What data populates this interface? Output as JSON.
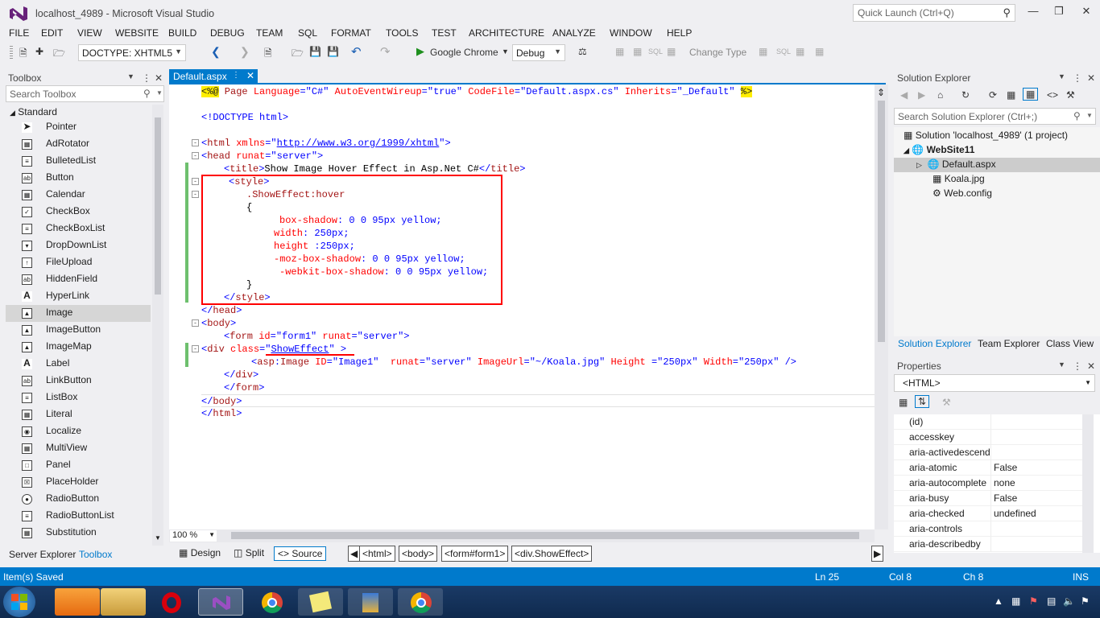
{
  "window": {
    "title": "localhost_4989 - Microsoft Visual Studio",
    "quick_launch": "Quick Launch (Ctrl+Q)"
  },
  "menu": [
    "FILE",
    "EDIT",
    "VIEW",
    "WEBSITE",
    "BUILD",
    "DEBUG",
    "TEAM",
    "SQL",
    "FORMAT",
    "TOOLS",
    "TEST",
    "ARCHITECTURE",
    "ANALYZE",
    "WINDOW",
    "HELP"
  ],
  "toolbar": {
    "doctype": "DOCTYPE: XHTML5",
    "browser": "Google Chrome",
    "config": "Debug",
    "change_type": "Change Type"
  },
  "toolbox": {
    "title": "Toolbox",
    "search_placeholder": "Search Toolbox",
    "group": "Standard",
    "items": [
      "Pointer",
      "AdRotator",
      "BulletedList",
      "Button",
      "Calendar",
      "CheckBox",
      "CheckBoxList",
      "DropDownList",
      "FileUpload",
      "HiddenField",
      "HyperLink",
      "Image",
      "ImageButton",
      "ImageMap",
      "Label",
      "LinkButton",
      "ListBox",
      "Literal",
      "Localize",
      "MultiView",
      "Panel",
      "PlaceHolder",
      "RadioButton",
      "RadioButtonList",
      "Substitution"
    ],
    "selected": "Image",
    "bottom_tabs": [
      "Server Explorer",
      "Toolbox"
    ]
  },
  "editor": {
    "tab": "Default.aspx",
    "zoom": "100 %",
    "view_buttons": [
      "Design",
      "Split",
      "Source"
    ],
    "breadcrumbs": [
      "<html>",
      "<body>",
      "<form#form1>",
      "<div.ShowEffect>"
    ],
    "lines": {
      "l1a": "<%@",
      "l1b": " Page ",
      "l1c": "Language",
      "l1d": "=",
      "l1e": "\"C#\"",
      "l1f": " AutoEventWireup",
      "l1g": "=",
      "l1h": "\"true\"",
      "l1i": " CodeFile",
      "l1j": "=",
      "l1k": "\"Default.aspx.cs\"",
      "l1l": " Inherits",
      "l1m": "=",
      "l1n": "\"_Default\"",
      "l1o": " ",
      "l1p": "%>",
      "l2": "<!DOCTYPE html>",
      "l3a": "<",
      "l3b": "html",
      "l3c": " xmlns",
      "l3d": "=\"",
      "l3e": "http://www.w3.org/1999/xhtml",
      "l3f": "\">",
      "l4a": "<",
      "l4b": "head",
      "l4c": " runat",
      "l4d": "=\"server\">",
      "l5a": "<",
      "l5b": "title",
      "l5c": ">",
      "l5d": "Show Image Hover Effect in Asp.Net C#",
      "l5e": "</",
      "l5f": "title",
      "l5g": ">",
      "l6a": "<",
      "l6b": "style",
      "l6c": ">",
      "l7": ".ShowEffect:hover",
      "l8": "{",
      "l9a": "box-shadow",
      "l9b": ": 0 0 95px yellow;",
      "l10a": "width",
      "l10b": ": 250px;",
      "l11a": "height",
      "l11b": " :250px;",
      "l12a": "-moz-box-shadow",
      "l12b": ": 0 0 95px yellow;",
      "l13a": "-webkit-box-shadow",
      "l13b": ": 0 0 95px yellow;",
      "l14": "}",
      "l15a": "</",
      "l15b": "style",
      "l15c": ">",
      "l16a": "</",
      "l16b": "head",
      "l16c": ">",
      "l17a": "<",
      "l17b": "body",
      "l17c": ">",
      "l18a": "<",
      "l18b": "form",
      "l18c": " id",
      "l18d": "=\"form1\"",
      "l18e": " runat",
      "l18f": "=\"server\">",
      "l19a": "<",
      "l19b": "div",
      "l19c": " class",
      "l19d": "=\"",
      "l19e": "ShowEffect",
      "l19f": "\" >",
      "l20a": "<",
      "l20b": "asp",
      "l20c": ":",
      "l20d": "Image",
      "l20e": " ID",
      "l20f": "=\"Image1\"",
      "l20g": "  runat",
      "l20h": "=\"server\"",
      "l20i": " ImageUrl",
      "l20j": "=\"~/Koala.jpg\"",
      "l20k": " Height",
      "l20l": " =\"250px\"",
      "l20m": " Width",
      "l20n": "=\"250px\"",
      "l20o": " />",
      "l21a": "</",
      "l21b": "div",
      "l21c": ">",
      "l22a": "</",
      "l22b": "form",
      "l22c": ">",
      "l23a": "</",
      "l23b": "body",
      "l23c": ">",
      "l24a": "</",
      "l24b": "html",
      "l24c": ">"
    }
  },
  "solution_explorer": {
    "title": "Solution Explorer",
    "search_placeholder": "Search Solution Explorer (Ctrl+;)",
    "solution": "Solution 'localhost_4989' (1 project)",
    "project": "WebSite11",
    "files": [
      "Default.aspx",
      "Koala.jpg",
      "Web.config"
    ],
    "tabs": [
      "Solution Explorer",
      "Team Explorer",
      "Class View"
    ]
  },
  "properties": {
    "title": "Properties",
    "selected": "<HTML>",
    "rows": [
      {
        "name": "(id)",
        "value": ""
      },
      {
        "name": "accesskey",
        "value": ""
      },
      {
        "name": "aria-activedescend",
        "value": ""
      },
      {
        "name": "aria-atomic",
        "value": "False"
      },
      {
        "name": "aria-autocomplete",
        "value": "none"
      },
      {
        "name": "aria-busy",
        "value": "False"
      },
      {
        "name": "aria-checked",
        "value": "undefined"
      },
      {
        "name": "aria-controls",
        "value": ""
      },
      {
        "name": "aria-describedby",
        "value": ""
      }
    ]
  },
  "status": {
    "message": "Item(s) Saved",
    "ln": "Ln 25",
    "col": "Col 8",
    "ch": "Ch 8",
    "mode": "INS"
  },
  "colors": {
    "accent": "#007acc",
    "highlight_box": "#ff0000",
    "change_bar": "#6ec06e"
  }
}
